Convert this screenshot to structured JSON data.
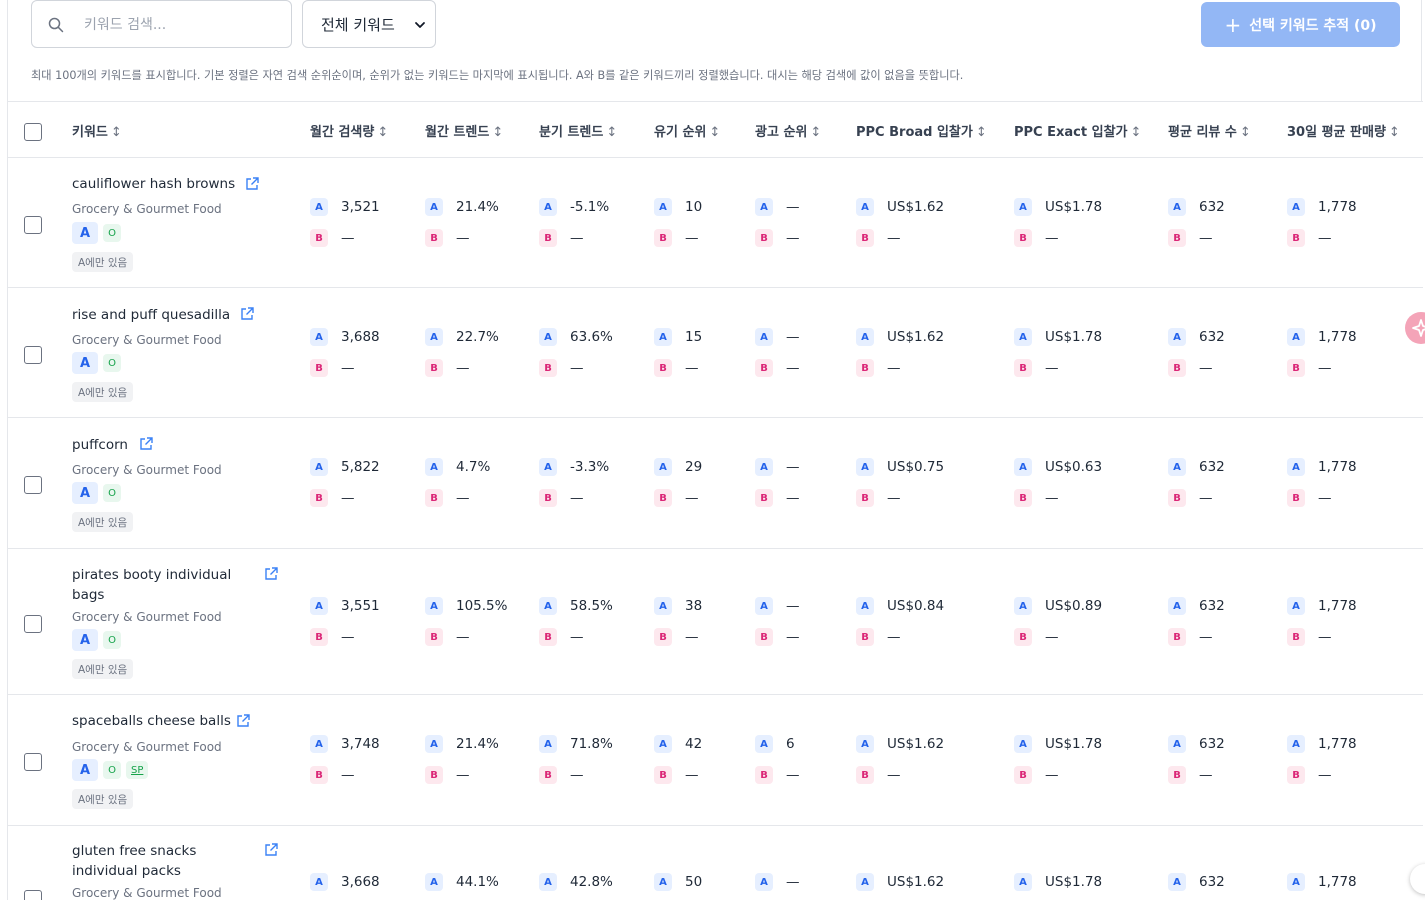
{
  "toolbar": {
    "search_placeholder": "키워드 검색...",
    "filter_value": "전체 키워드",
    "track_button_label": "선택 키워드 추적 (0)"
  },
  "notice": "최대 100개의 키워드를 표시합니다. 기본 정렬은 자연 검색 순위순이며, 순위가 없는 키워드는 마지막에 표시됩니다. A와 B를 같은 키워드끼리 정렬했습니다. 대시는 해당 검색에 값이 없음을 뜻합니다.",
  "headers": {
    "keyword": "키워드",
    "monthly_search": "월간 검색량",
    "monthly_trend": "월간 트렌드",
    "quarterly_trend": "분기 트렌드",
    "organic_rank": "유기 순위",
    "ad_rank": "광고 순위",
    "ppc_broad": "PPC Broad 입찰가",
    "ppc_exact": "PPC Exact 입찰가",
    "avg_reviews": "평균 리뷰 수",
    "sales_30d": "30일 평균 판매량",
    "sort_glyph": "↕"
  },
  "labels": {
    "a": "A",
    "b": "B",
    "o": "O",
    "sp": "SP",
    "dash": "—",
    "only_a": "A에만 있음"
  },
  "rows": [
    {
      "keyword": "cauliflower hash browns",
      "category": "Grocery & Gourmet Food",
      "sp": false,
      "search": "3,521",
      "mtrend": "21.4%",
      "qtrend": "-5.1%",
      "organic": "10",
      "ad": "—",
      "broad": "US$1.62",
      "exact": "US$1.78",
      "reviews": "632",
      "sales": "1,778"
    },
    {
      "keyword": "rise and puff quesadilla",
      "category": "Grocery & Gourmet Food",
      "sp": false,
      "search": "3,688",
      "mtrend": "22.7%",
      "qtrend": "63.6%",
      "organic": "15",
      "ad": "—",
      "broad": "US$1.62",
      "exact": "US$1.78",
      "reviews": "632",
      "sales": "1,778"
    },
    {
      "keyword": "puffcorn",
      "category": "Grocery & Gourmet Food",
      "sp": false,
      "search": "5,822",
      "mtrend": "4.7%",
      "qtrend": "-3.3%",
      "organic": "29",
      "ad": "—",
      "broad": "US$0.75",
      "exact": "US$0.63",
      "reviews": "632",
      "sales": "1,778"
    },
    {
      "keyword": "pirates booty individual bags",
      "category": "Grocery & Gourmet Food",
      "sp": false,
      "search": "3,551",
      "mtrend": "105.5%",
      "qtrend": "58.5%",
      "organic": "38",
      "ad": "—",
      "broad": "US$0.84",
      "exact": "US$0.89",
      "reviews": "632",
      "sales": "1,778"
    },
    {
      "keyword": "spaceballs cheese balls",
      "category": "Grocery & Gourmet Food",
      "sp": true,
      "search": "3,748",
      "mtrend": "21.4%",
      "qtrend": "71.8%",
      "organic": "42",
      "ad": "6",
      "broad": "US$1.62",
      "exact": "US$1.78",
      "reviews": "632",
      "sales": "1,778"
    },
    {
      "keyword": "gluten free snacks individual packs",
      "category": "Grocery & Gourmet Food",
      "sp": false,
      "search": "3,668",
      "mtrend": "44.1%",
      "qtrend": "42.8%",
      "organic": "50",
      "ad": "—",
      "broad": "US$1.62",
      "exact": "US$1.78",
      "reviews": "632",
      "sales": "1,778"
    }
  ],
  "colors": {
    "accent_button": "#93b7f5",
    "badge_a_bg": "#e6efff",
    "badge_a_fg": "#2563eb",
    "badge_b_bg": "#fde8ee",
    "badge_b_fg": "#db2777",
    "tag_o_fg": "#16a34a"
  }
}
